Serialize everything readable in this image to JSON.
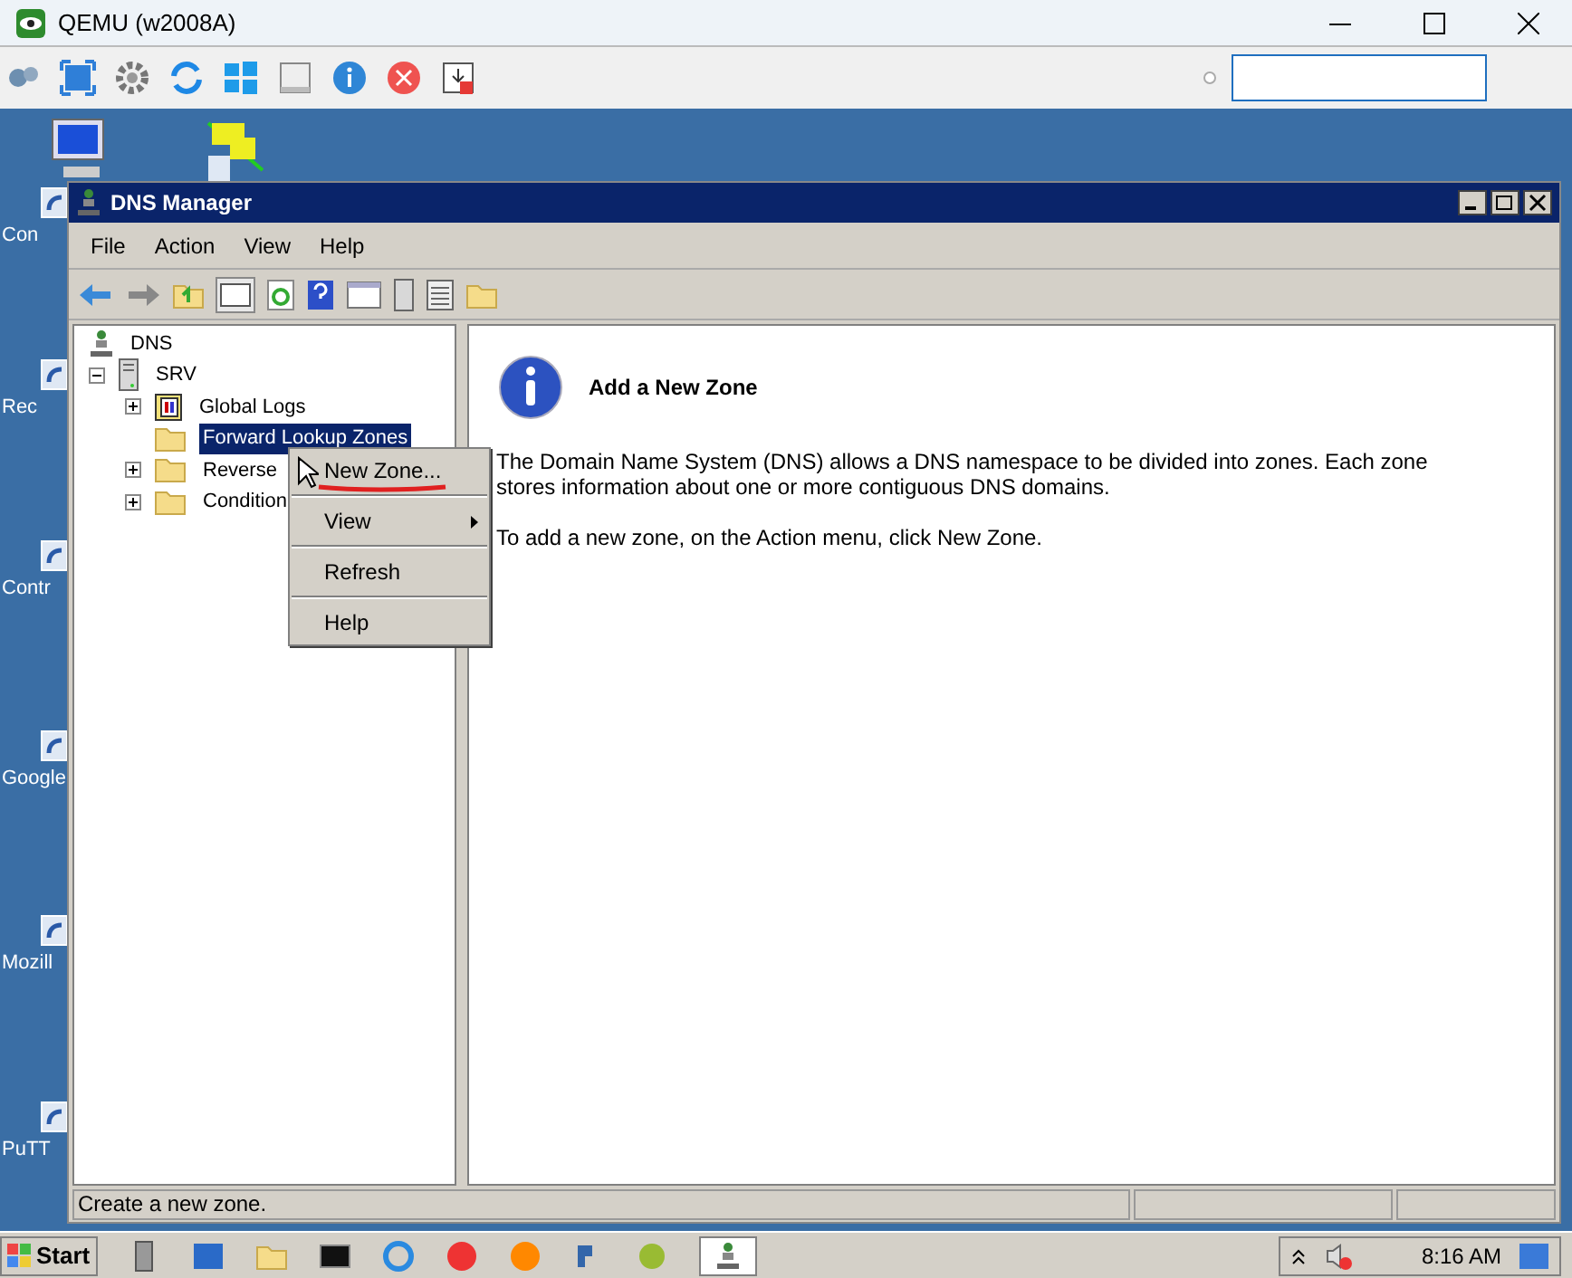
{
  "host": {
    "title": "QEMU (w2008A)"
  },
  "desktop_icons": [
    {
      "label": "Con"
    },
    {
      "label": "Rec"
    },
    {
      "label": "Contr"
    },
    {
      "label": "Google"
    },
    {
      "label": "Mozill"
    },
    {
      "label": "PuTT"
    }
  ],
  "window": {
    "title": "DNS Manager"
  },
  "menu_bar": [
    "File",
    "Action",
    "View",
    "Help"
  ],
  "tree": [
    {
      "label": "DNS",
      "kind": "root",
      "selected": false,
      "children": [
        {
          "label": "SRV",
          "kind": "server",
          "expanded": true,
          "selected": false,
          "children": [
            {
              "label": "Global Logs",
              "kind": "logs",
              "expanded": false,
              "selected": false
            },
            {
              "label": "Forward Lookup Zones",
              "kind": "folder",
              "selected": true
            },
            {
              "label": "Reverse",
              "kind": "folder",
              "expanded": false,
              "selected": false
            },
            {
              "label": "Condition",
              "kind": "folder",
              "expanded": false,
              "selected": false
            }
          ]
        }
      ]
    }
  ],
  "context_menu": [
    {
      "label": "New Zone...",
      "submenu": false
    },
    {
      "label": "View",
      "submenu": true
    },
    {
      "label": "Refresh",
      "submenu": false
    },
    {
      "label": "Help",
      "submenu": false
    }
  ],
  "details": {
    "heading": "Add a New Zone",
    "paragraphs": [
      "The Domain Name System (DNS) allows a DNS namespace to be divided into zones. Each zone stores information about one or more contiguous DNS domains.",
      "To add a new zone, on the Action menu, click New Zone."
    ]
  },
  "status_bar": "Create a new zone.",
  "taskbar": {
    "start": "Start",
    "clock": "8:16 AM"
  }
}
